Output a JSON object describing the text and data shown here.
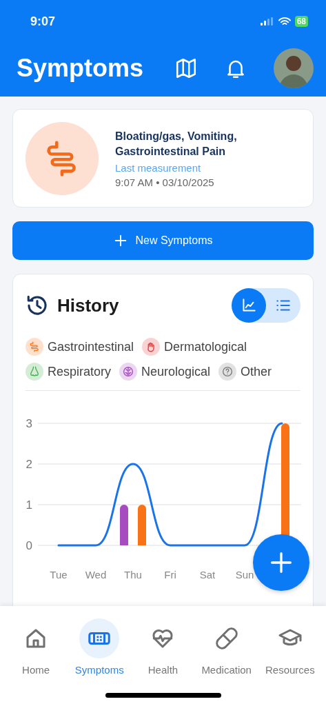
{
  "status_bar": {
    "time": "9:07",
    "battery": "68"
  },
  "header": {
    "title": "Symptoms"
  },
  "latest": {
    "symptoms": "Bloating/gas, Vomiting, Gastrointestinal Pain",
    "caption": "Last measurement",
    "timestamp": "9:07 AM • 03/10/2025"
  },
  "new_button": {
    "label": "New Symptoms"
  },
  "history": {
    "title": "History",
    "view_toggle": [
      {
        "kind": "chart",
        "selected": true
      },
      {
        "kind": "list",
        "selected": false
      }
    ],
    "legend": [
      {
        "kind": "gastro",
        "label": "Gastrointestinal",
        "color": "#f97316"
      },
      {
        "kind": "derma",
        "label": "Dermatological",
        "color": "#e53935"
      },
      {
        "kind": "resp",
        "label": "Respiratory",
        "color": "#3fae4a"
      },
      {
        "kind": "neuro",
        "label": "Neurological",
        "color": "#a64bc0"
      },
      {
        "kind": "other",
        "label": "Other",
        "color": "#7a7a7a"
      }
    ],
    "chart_data": {
      "type": "bar",
      "categories": [
        "Tue",
        "Wed",
        "Thu",
        "Fri",
        "Sat",
        "Sun",
        null
      ],
      "ylim": [
        0,
        3
      ],
      "yticks": [
        0,
        1,
        2,
        3
      ],
      "series": [
        {
          "type": "line",
          "color": "#1a73e8",
          "values": [
            0,
            0,
            2,
            0,
            0,
            0,
            3
          ]
        },
        {
          "color": "#a64bc0",
          "values": [
            null,
            null,
            1,
            null,
            null,
            null,
            null
          ]
        },
        {
          "color": "#f97316",
          "values": [
            null,
            null,
            1,
            null,
            null,
            null,
            3
          ]
        }
      ]
    }
  },
  "nav": [
    {
      "kind": "home",
      "label": "Home",
      "selected": false
    },
    {
      "kind": "bandage",
      "label": "Symptoms",
      "selected": true
    },
    {
      "kind": "heart",
      "label": "Health",
      "selected": false
    },
    {
      "kind": "pill",
      "label": "Medication",
      "selected": false
    },
    {
      "kind": "cap",
      "label": "Resources",
      "selected": false
    }
  ]
}
